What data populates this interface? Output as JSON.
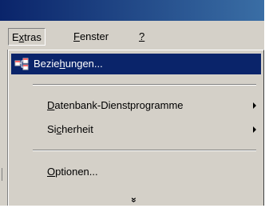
{
  "menubar": {
    "items": [
      {
        "pre": "E",
        "u": "x",
        "post": "tras"
      },
      {
        "pre": "",
        "u": "F",
        "post": "enster"
      },
      {
        "pre": "",
        "u": "?",
        "post": ""
      }
    ]
  },
  "menu": {
    "items": [
      {
        "pre": "Bezie",
        "u": "h",
        "post": "ungen...",
        "icon": "relationships-icon"
      },
      {
        "pre": "",
        "u": "D",
        "post": "atenbank-Dienstprogramme"
      },
      {
        "pre": "Si",
        "u": "c",
        "post": "herheit"
      },
      {
        "pre": "",
        "u": "O",
        "post": "ptionen..."
      }
    ],
    "expand_glyph": "»"
  },
  "colors": {
    "highlight": "#0a246a",
    "menu_bg": "#d4d0c8"
  }
}
